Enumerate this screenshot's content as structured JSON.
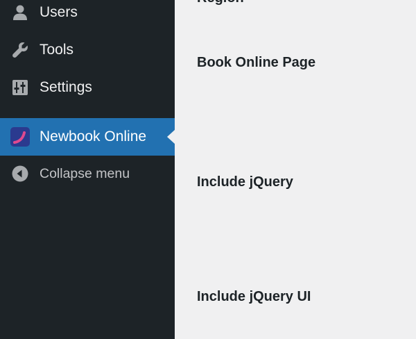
{
  "sidebar": {
    "items": [
      {
        "label": "Users",
        "icon": "users-icon"
      },
      {
        "label": "Tools",
        "icon": "wrench-icon"
      },
      {
        "label": "Settings",
        "icon": "settings-sliders-icon"
      },
      {
        "label": "Newbook Online",
        "icon": "newbook-logo-icon",
        "active": true
      },
      {
        "label": "Collapse menu",
        "icon": "collapse-arrow-icon"
      }
    ]
  },
  "content": {
    "labels": {
      "region": "Region",
      "book_online_page": "Book Online Page",
      "include_jquery": "Include jQuery",
      "include_jquery_ui": "Include jQuery UI"
    }
  },
  "colors": {
    "sidebar_bg": "#1d2327",
    "active_bg": "#2271b1",
    "content_bg": "#f0f0f1",
    "text_light": "#f0f0f1",
    "text_muted": "#c3c4c7",
    "text_dark": "#1d2327"
  }
}
